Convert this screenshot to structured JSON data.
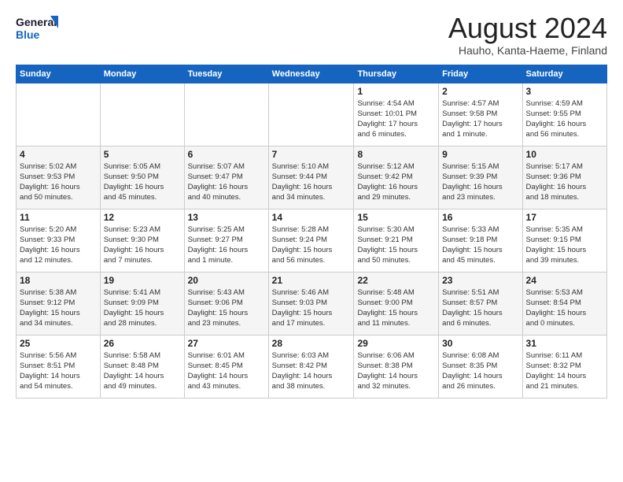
{
  "logo": {
    "line1": "General",
    "line2": "Blue"
  },
  "title": "August 2024",
  "subtitle": "Hauho, Kanta-Haeme, Finland",
  "weekdays": [
    "Sunday",
    "Monday",
    "Tuesday",
    "Wednesday",
    "Thursday",
    "Friday",
    "Saturday"
  ],
  "weeks": [
    [
      {
        "day": "",
        "info": ""
      },
      {
        "day": "",
        "info": ""
      },
      {
        "day": "",
        "info": ""
      },
      {
        "day": "",
        "info": ""
      },
      {
        "day": "1",
        "info": "Sunrise: 4:54 AM\nSunset: 10:01 PM\nDaylight: 17 hours\nand 6 minutes."
      },
      {
        "day": "2",
        "info": "Sunrise: 4:57 AM\nSunset: 9:58 PM\nDaylight: 17 hours\nand 1 minute."
      },
      {
        "day": "3",
        "info": "Sunrise: 4:59 AM\nSunset: 9:55 PM\nDaylight: 16 hours\nand 56 minutes."
      }
    ],
    [
      {
        "day": "4",
        "info": "Sunrise: 5:02 AM\nSunset: 9:53 PM\nDaylight: 16 hours\nand 50 minutes."
      },
      {
        "day": "5",
        "info": "Sunrise: 5:05 AM\nSunset: 9:50 PM\nDaylight: 16 hours\nand 45 minutes."
      },
      {
        "day": "6",
        "info": "Sunrise: 5:07 AM\nSunset: 9:47 PM\nDaylight: 16 hours\nand 40 minutes."
      },
      {
        "day": "7",
        "info": "Sunrise: 5:10 AM\nSunset: 9:44 PM\nDaylight: 16 hours\nand 34 minutes."
      },
      {
        "day": "8",
        "info": "Sunrise: 5:12 AM\nSunset: 9:42 PM\nDaylight: 16 hours\nand 29 minutes."
      },
      {
        "day": "9",
        "info": "Sunrise: 5:15 AM\nSunset: 9:39 PM\nDaylight: 16 hours\nand 23 minutes."
      },
      {
        "day": "10",
        "info": "Sunrise: 5:17 AM\nSunset: 9:36 PM\nDaylight: 16 hours\nand 18 minutes."
      }
    ],
    [
      {
        "day": "11",
        "info": "Sunrise: 5:20 AM\nSunset: 9:33 PM\nDaylight: 16 hours\nand 12 minutes."
      },
      {
        "day": "12",
        "info": "Sunrise: 5:23 AM\nSunset: 9:30 PM\nDaylight: 16 hours\nand 7 minutes."
      },
      {
        "day": "13",
        "info": "Sunrise: 5:25 AM\nSunset: 9:27 PM\nDaylight: 16 hours\nand 1 minute."
      },
      {
        "day": "14",
        "info": "Sunrise: 5:28 AM\nSunset: 9:24 PM\nDaylight: 15 hours\nand 56 minutes."
      },
      {
        "day": "15",
        "info": "Sunrise: 5:30 AM\nSunset: 9:21 PM\nDaylight: 15 hours\nand 50 minutes."
      },
      {
        "day": "16",
        "info": "Sunrise: 5:33 AM\nSunset: 9:18 PM\nDaylight: 15 hours\nand 45 minutes."
      },
      {
        "day": "17",
        "info": "Sunrise: 5:35 AM\nSunset: 9:15 PM\nDaylight: 15 hours\nand 39 minutes."
      }
    ],
    [
      {
        "day": "18",
        "info": "Sunrise: 5:38 AM\nSunset: 9:12 PM\nDaylight: 15 hours\nand 34 minutes."
      },
      {
        "day": "19",
        "info": "Sunrise: 5:41 AM\nSunset: 9:09 PM\nDaylight: 15 hours\nand 28 minutes."
      },
      {
        "day": "20",
        "info": "Sunrise: 5:43 AM\nSunset: 9:06 PM\nDaylight: 15 hours\nand 23 minutes."
      },
      {
        "day": "21",
        "info": "Sunrise: 5:46 AM\nSunset: 9:03 PM\nDaylight: 15 hours\nand 17 minutes."
      },
      {
        "day": "22",
        "info": "Sunrise: 5:48 AM\nSunset: 9:00 PM\nDaylight: 15 hours\nand 11 minutes."
      },
      {
        "day": "23",
        "info": "Sunrise: 5:51 AM\nSunset: 8:57 PM\nDaylight: 15 hours\nand 6 minutes."
      },
      {
        "day": "24",
        "info": "Sunrise: 5:53 AM\nSunset: 8:54 PM\nDaylight: 15 hours\nand 0 minutes."
      }
    ],
    [
      {
        "day": "25",
        "info": "Sunrise: 5:56 AM\nSunset: 8:51 PM\nDaylight: 14 hours\nand 54 minutes."
      },
      {
        "day": "26",
        "info": "Sunrise: 5:58 AM\nSunset: 8:48 PM\nDaylight: 14 hours\nand 49 minutes."
      },
      {
        "day": "27",
        "info": "Sunrise: 6:01 AM\nSunset: 8:45 PM\nDaylight: 14 hours\nand 43 minutes."
      },
      {
        "day": "28",
        "info": "Sunrise: 6:03 AM\nSunset: 8:42 PM\nDaylight: 14 hours\nand 38 minutes."
      },
      {
        "day": "29",
        "info": "Sunrise: 6:06 AM\nSunset: 8:38 PM\nDaylight: 14 hours\nand 32 minutes."
      },
      {
        "day": "30",
        "info": "Sunrise: 6:08 AM\nSunset: 8:35 PM\nDaylight: 14 hours\nand 26 minutes."
      },
      {
        "day": "31",
        "info": "Sunrise: 6:11 AM\nSunset: 8:32 PM\nDaylight: 14 hours\nand 21 minutes."
      }
    ]
  ]
}
